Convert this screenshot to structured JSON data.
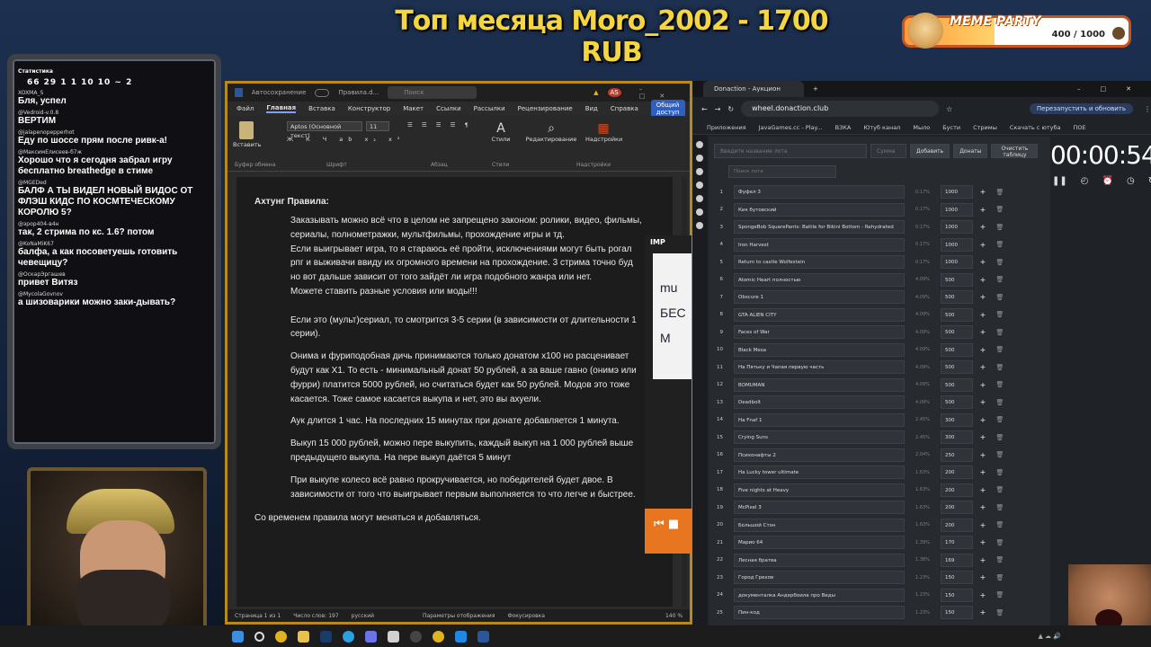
{
  "stream": {
    "banner": "Топ месяца Moro_2002 - 1700 RUB",
    "goal": {
      "title": "MEME PARTY",
      "count": "400 / 1000",
      "progress": 0.4
    }
  },
  "chat": {
    "stats_label": "Статистика",
    "stats_values": "66 29 1 1 10 10 ~ 2",
    "messages": [
      {
        "user": "XOXMA_S",
        "text": "Бля, успел"
      },
      {
        "user": "@Vedroid-v.0.8",
        "text": "ВЕРТИМ"
      },
      {
        "user": "@jalapenopepperhot",
        "text": "Еду по шоссе прям после ривк-а!"
      },
      {
        "user": "@МаксимЕлисеев-б7ж",
        "text": "Хорошо что я сегодня забрал игру бесплатно breathedge в стиме"
      },
      {
        "user": "@MGEDed",
        "text": "БАЛФ А ТЫ ВИДЕЛ НОВЫЙ ВИДОС ОТ ФЛЭШ КИДС ПО КОСМТЕЧЕСКОМУ КОРОЛЮ 5?"
      },
      {
        "user": "@эрор404-в4н",
        "text": "так, 2 стрима по кс. 1.6? потом"
      },
      {
        "user": "@KoNaMiK67",
        "text": "балфа, а как посоветуешь готовить чевещицу?"
      },
      {
        "user": "@ОскарЭргашев",
        "text": "привет Витяз"
      },
      {
        "user": "@MycolaGovnov",
        "text": "а шизоварики можно заки-дывать?"
      }
    ]
  },
  "word": {
    "autosave": "Автосохранение",
    "filename": "Правила.d...",
    "search": "Поиск",
    "user_initials": "AS",
    "menus": [
      "Файл",
      "Главная",
      "Вставка",
      "Конструктор",
      "Макет",
      "Ссылки",
      "Рассылки",
      "Рецензирование",
      "Вид",
      "Справка"
    ],
    "share": "Общий доступ",
    "ribbon": {
      "paste": "Вставить",
      "font": "Aptos (Основной текст)",
      "size": "11",
      "styles": "Стили",
      "editing": "Редактирование",
      "addins": "Надстройки",
      "groups": [
        "Буфер обмена",
        "Шрифт",
        "Абзац",
        "Стили",
        "Надстройки"
      ]
    },
    "doc": {
      "title": "Ахтунг Правила:",
      "rules": [
        [
          "Заказывать можно всё что в целом не запрещено законом: ролики, видео, фильмы,",
          "сериалы, полнометражки, мультфильмы, прохождение игры и тд.",
          "Если выигрывает игра, то я стараюсь её пройти, исключениями могут быть рогал",
          "рпг и выживачи ввиду их огромного времени на прохождение. 3 стрима точно буд",
          "но вот дальше зависит от того зайдёт ли игра подобного жанра или нет.",
          "Можете ставить разные условия или моды!!!",
          "",
          "Если это (мульт)сериал, то смотрится 3-5 серии (в зависимости от длительности 1",
          "серии)."
        ],
        [
          "Онима и фуриподобная дичь принимаются только донатом х100 но расценивает",
          "будут как Х1. То есть - минимальный донат 50 рублей, а за ваше гавно (онимэ или",
          "фурри) платится 5000 рублей, но считаться будет как 50 рублей. Модов это тоже",
          "касается. Тоже самое касается выкупа и нет, это вы ахуели."
        ],
        [
          "Аук длится 1 час. На последних 15 минутах при донате добавляется 1 минута."
        ],
        [
          "Выкуп 15 000 рублей, можно пере выкупить, каждый выкуп на 1 000 рублей выше",
          "предыдущего выкупа. На пере выкуп даётся 5 минут"
        ],
        [
          "При выкупе колесо всё равно прокручивается, но победителей будет двое. В",
          "зависимости от того что выигрывает первым выполняется то что легче и быстрее."
        ]
      ],
      "footer": "Со временем правила могут меняться и добавляться."
    },
    "status": {
      "page": "Страница 1 из 1",
      "words": "Число слов: 197",
      "lang": "русский",
      "view": "Параметры отображения",
      "focus": "Фокусировка",
      "zoom": "140 %"
    }
  },
  "imp": {
    "label": "IMP",
    "poster": "mu БЕС М"
  },
  "browser": {
    "tab": "Donaction - Аукцион",
    "url": "wheel.donaction.club",
    "restart": "Перезапустить и обновить",
    "bookmarks": [
      "Приложения",
      "JavaGames.cc - Play...",
      "ВЗКА",
      "Ютуб канал",
      "Мыло",
      "Бусти",
      "Стримы",
      "Скачать с ютуба",
      "ПОЕ"
    ]
  },
  "auction": {
    "lot_placeholder": "Введите название лота",
    "sum_placeholder": "Сумма",
    "add": "Добавить",
    "donations": "Донаты",
    "clear": "Очистить таблицу",
    "search": "Поиск лота",
    "timer": "00:00:54",
    "lots": [
      {
        "n": "1",
        "name": "Фуфел 3",
        "pct": "0.17%",
        "amt": "1000"
      },
      {
        "n": "2",
        "name": "Кик бутовский",
        "pct": "0.17%",
        "amt": "1000"
      },
      {
        "n": "3",
        "name": "SpongeBob SquarePants: Battle for Bikini Bottom - Rehydrated",
        "pct": "0.17%",
        "amt": "1000"
      },
      {
        "n": "4",
        "name": "Iron Harvest",
        "pct": "0.17%",
        "amt": "1000"
      },
      {
        "n": "5",
        "name": "Return to castle Wolfestein",
        "pct": "0.17%",
        "amt": "1000"
      },
      {
        "n": "6",
        "name": "Atomic Heart полностью",
        "pct": "4.09%",
        "amt": "500"
      },
      {
        "n": "7",
        "name": "Obscure 1",
        "pct": "4.09%",
        "amt": "500"
      },
      {
        "n": "8",
        "name": "GTA ALIEN CITY",
        "pct": "4.09%",
        "amt": "500"
      },
      {
        "n": "9",
        "name": "Faces of War",
        "pct": "4.09%",
        "amt": "500"
      },
      {
        "n": "10",
        "name": "Black Mesa",
        "pct": "4.09%",
        "amt": "500"
      },
      {
        "n": "11",
        "name": "На Пятьку и Чапая первую часть",
        "pct": "4.09%",
        "amt": "500"
      },
      {
        "n": "12",
        "name": "BOMUMAN",
        "pct": "4.09%",
        "amt": "500"
      },
      {
        "n": "13",
        "name": "Deadbolt",
        "pct": "4.09%",
        "amt": "500"
      },
      {
        "n": "14",
        "name": "На Fnaf 1",
        "pct": "2.45%",
        "amt": "300"
      },
      {
        "n": "15",
        "name": "Crying Suns",
        "pct": "2.45%",
        "amt": "300"
      },
      {
        "n": "16",
        "name": "Психонафты 2",
        "pct": "2.04%",
        "amt": "250"
      },
      {
        "n": "17",
        "name": "На Lucky tower ultimate",
        "pct": "1.63%",
        "amt": "200"
      },
      {
        "n": "18",
        "name": "Five nights at Heavy",
        "pct": "1.63%",
        "amt": "200"
      },
      {
        "n": "19",
        "name": "McPixel 3",
        "pct": "1.63%",
        "amt": "200"
      },
      {
        "n": "20",
        "name": "Большой Стэн",
        "pct": "1.63%",
        "amt": "200"
      },
      {
        "n": "21",
        "name": "Марио 64",
        "pct": "1.39%",
        "amt": "170"
      },
      {
        "n": "22",
        "name": "Лесная братва",
        "pct": "1.38%",
        "amt": "169"
      },
      {
        "n": "23",
        "name": "Город Грехов",
        "pct": "1.23%",
        "amt": "150"
      },
      {
        "n": "24",
        "name": "документалка Андербоила про Веды",
        "pct": "1.23%",
        "amt": "150"
      },
      {
        "n": "25",
        "name": "Пин-код",
        "pct": "1.23%",
        "amt": "150"
      }
    ]
  },
  "colors": {
    "banner": "#f6d63e",
    "accent": "#2f5fbf",
    "frame": "#b88a1b"
  }
}
